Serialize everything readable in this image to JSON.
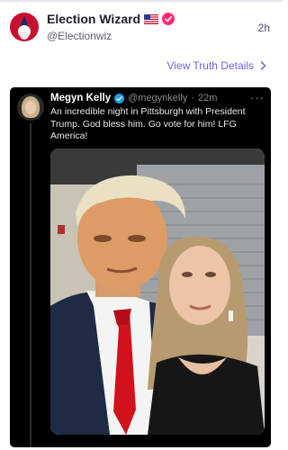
{
  "post": {
    "author_name": "Election Wizard",
    "handle": "@Electionwiz",
    "time": "2h",
    "view_link": "View Truth Details"
  },
  "embed": {
    "author_name": "Megyn Kelly",
    "handle": "@megynkelly",
    "separator": "·",
    "time": "22m",
    "more": "···",
    "text": "An incredible night in Pittsburgh with President Trump. God bless him. Go vote for him! LFG America!"
  },
  "colors": {
    "accent": "#6b62e0",
    "verified": "#ff2d6f",
    "embed_verified": "#1d9bf0"
  }
}
